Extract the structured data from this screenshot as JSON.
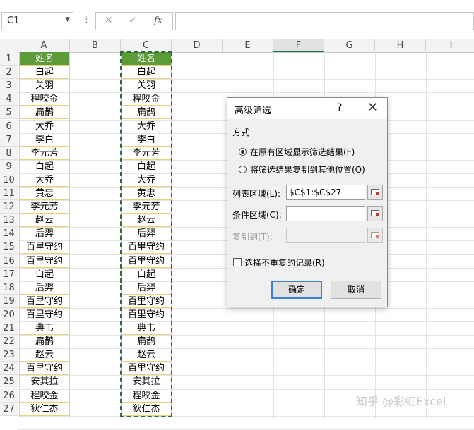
{
  "formula_bar": {
    "name_box": "C1",
    "cancel_icon": "✕",
    "enter_icon": "✓",
    "fx_label": "fx",
    "formula": ""
  },
  "columns": [
    "A",
    "B",
    "C",
    "D",
    "E",
    "F",
    "G",
    "H",
    "I"
  ],
  "selected_column": "F",
  "rows": [
    "1",
    "2",
    "3",
    "4",
    "5",
    "6",
    "7",
    "8",
    "9",
    "10",
    "11",
    "12",
    "13",
    "14",
    "15",
    "16",
    "17",
    "18",
    "19",
    "20",
    "21",
    "22",
    "23",
    "24",
    "25",
    "26",
    "27"
  ],
  "col_a": [
    "姓名",
    "白起",
    "关羽",
    "程咬金",
    "扁鹊",
    "大乔",
    "李白",
    "李元芳",
    "白起",
    "大乔",
    "黄忠",
    "李元芳",
    "赵云",
    "后羿",
    "百里守约",
    "百里守约",
    "白起",
    "后羿",
    "百里守约",
    "百里守约",
    "典韦",
    "扁鹊",
    "赵云",
    "百里守约",
    "安其拉",
    "程咬金",
    "狄仁杰"
  ],
  "col_c": [
    "姓名",
    "白起",
    "关羽",
    "程咬金",
    "扁鹊",
    "大乔",
    "李白",
    "李元芳",
    "白起",
    "大乔",
    "黄忠",
    "李元芳",
    "赵云",
    "后羿",
    "百里守约",
    "百里守约",
    "白起",
    "后羿",
    "百里守约",
    "百里守约",
    "典韦",
    "扁鹊",
    "赵云",
    "百里守约",
    "安其拉",
    "程咬金",
    "狄仁杰"
  ],
  "dialog": {
    "title": "高级筛选",
    "help": "?",
    "close": "✕",
    "section_label": "方式",
    "option1": "在原有区域显示筛选结果(F)",
    "option2": "将筛选结果复制到其他位置(O)",
    "list_range_label": "列表区域(L):",
    "list_range_value": "$C$1:$C$27",
    "criteria_label": "条件区域(C):",
    "criteria_value": "",
    "copy_to_label": "复制到(T):",
    "copy_to_value": "",
    "unique_label": "选择不重复的记录(R)",
    "ok": "确定",
    "cancel": "取消"
  },
  "watermark": "知乎 @彩虹Excel",
  "colors": {
    "header_fill": "#5c9a3a",
    "marquee": "#2e6b3a",
    "cell_border": "#e8d27a",
    "accent": "#217346"
  }
}
